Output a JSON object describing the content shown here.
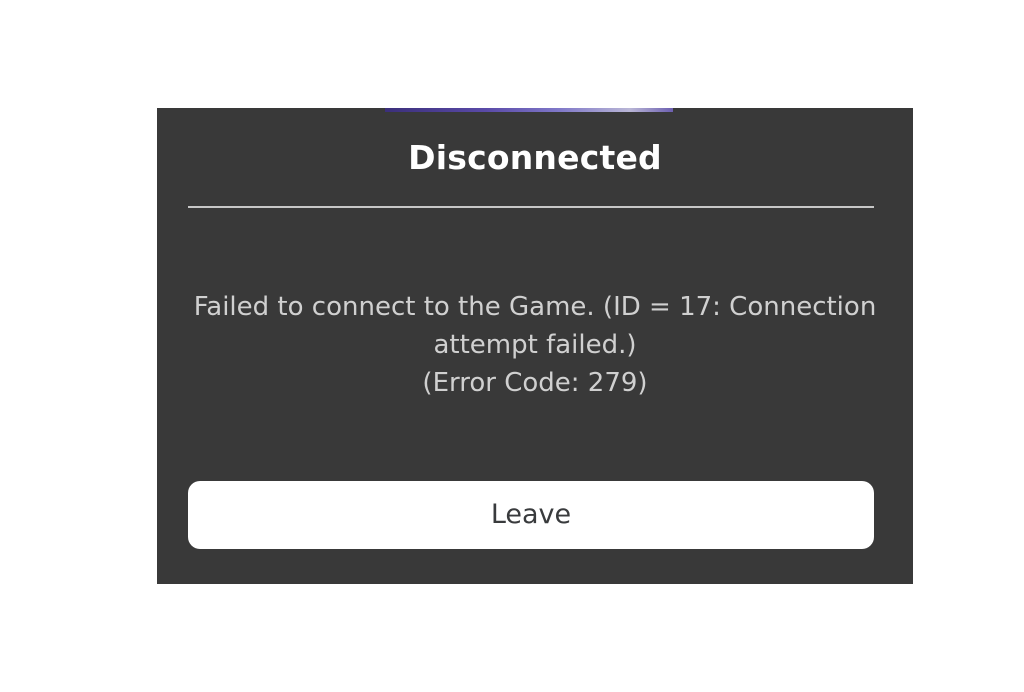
{
  "dialog": {
    "title": "Disconnected",
    "message_line1": "Failed to connect to the Game. (ID = 17: Connection",
    "message_line2": "attempt failed.)",
    "error_code": "(Error Code: 279)",
    "leave_label": "Leave"
  },
  "colors": {
    "dialog_bg": "#393939",
    "title": "#ffffff",
    "message": "#d0d0d0",
    "button_bg": "#ffffff",
    "button_text": "#393b3d",
    "page_bg": "#ffffff"
  },
  "icons": {
    "thumbnail": "game-thumbnail-strip"
  }
}
